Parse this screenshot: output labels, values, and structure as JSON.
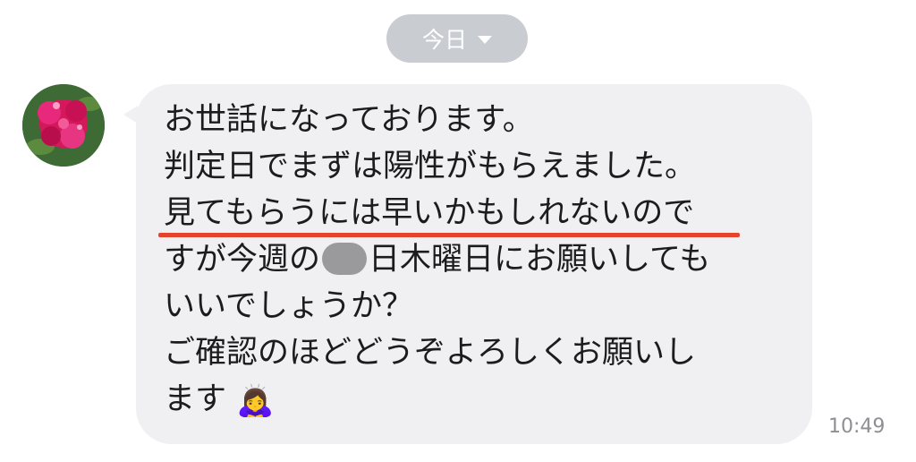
{
  "date_pill": {
    "label": "今日"
  },
  "message": {
    "lines": [
      "お世話になっております。",
      "判定日でまずは陽性がもらえました。",
      "見てもらうには早いかもしれないので",
      "すが今週の",
      "日木曜日にお願いしても",
      "いいでしょうか？",
      "ご確認のほどどうぞよろしくお願いし",
      "ます",
      "🙇‍♀️"
    ],
    "time": "10:49"
  },
  "colors": {
    "bubble": "#f0f0f2",
    "underline": "#e4442c",
    "date_pill": "#c9ccd1"
  }
}
